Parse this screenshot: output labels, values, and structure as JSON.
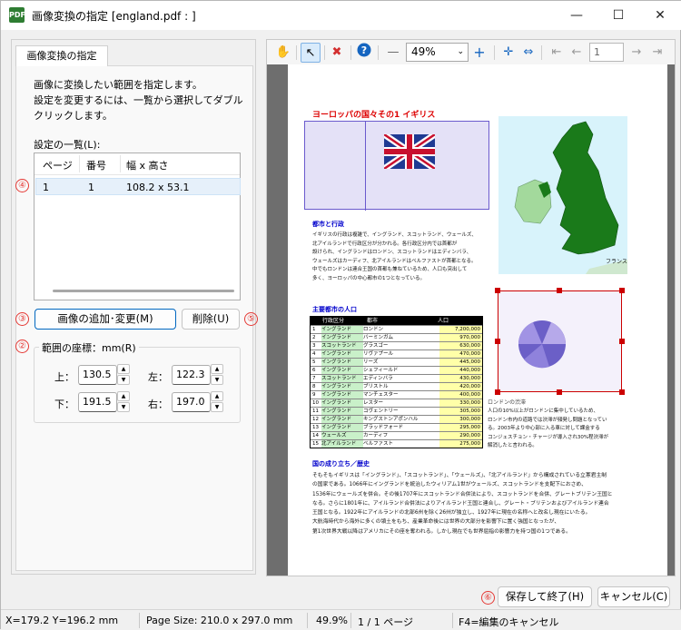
{
  "window": {
    "title": "画像変換の指定 [england.pdf : ]",
    "app_icon": "pdf-app-icon"
  },
  "left_panel": {
    "tab_label": "画像変換の指定",
    "description": [
      "画像に変換したい範囲を指定します。",
      "設定を変更するには、一覧から選択してダブル",
      "クリックします。"
    ],
    "settings_list_label": "設定の一覧(L):",
    "list_columns": [
      "ページ",
      "番号",
      "幅 x 高さ"
    ],
    "list_rows": [
      {
        "page": "1",
        "number": "1",
        "size": "108.2 x 53.1"
      }
    ],
    "add_change_button": "画像の追加･変更(M)",
    "delete_button": "削除(U)",
    "range_group_title": "範囲の座標：mm(R)",
    "coords": {
      "top_label": "上：",
      "top_value": "130.5",
      "left_label": "左：",
      "left_value": "122.3",
      "bottom_label": "下：",
      "bottom_value": "191.5",
      "right_label": "右：",
      "right_value": "197.0"
    }
  },
  "annotations": [
    "①",
    "②",
    "③",
    "④",
    "⑤",
    "⑥"
  ],
  "toolbar": {
    "zoom": "49%",
    "page_number": "1"
  },
  "document": {
    "heading": "ヨーロッパの国々その1 イギリス",
    "section_city": "都市と行政",
    "section_major": "主要都市の人口",
    "section_history": "国の成り立ち／歴史",
    "city_text": [
      "イギリスの行政は複雑で、イングランド、スコットランド、ウェールズ、",
      "北アイルランドで行政区分が分かれる。各行政区分内では首都が",
      "設けられ、イングランドはロンドン、スコットランドはエディンバラ、",
      "ウェールズはカーディフ、北アイルランドはベルファストが首都となる。",
      "中でもロンドンは連合王国の首都も兼ねているため、人口も突出して",
      "多く、ヨーロッパの中心都市の1つとなっている。"
    ],
    "table_headers": [
      "行政区分",
      "都市",
      "人口"
    ],
    "table_rows": [
      [
        "1",
        "イングランド",
        "ロンドン",
        "7,200,000"
      ],
      [
        "2",
        "イングランド",
        "バーミンガム",
        "970,000"
      ],
      [
        "3",
        "スコットランド",
        "グラスゴー",
        "630,000"
      ],
      [
        "4",
        "イングランド",
        "リヴァプール",
        "470,000"
      ],
      [
        "5",
        "イングランド",
        "リーズ",
        "445,000"
      ],
      [
        "6",
        "イングランド",
        "シェフィールド",
        "440,000"
      ],
      [
        "7",
        "スコットランド",
        "エディンバラ",
        "430,000"
      ],
      [
        "8",
        "イングランド",
        "ブリストル",
        "420,000"
      ],
      [
        "9",
        "イングランド",
        "マンチェスター",
        "400,000"
      ],
      [
        "10",
        "イングランド",
        "レスター",
        "330,000"
      ],
      [
        "11",
        "イングランド",
        "コヴェントリー",
        "305,000"
      ],
      [
        "12",
        "イングランド",
        "キングストンアポンハル",
        "300,000"
      ],
      [
        "13",
        "イングランド",
        "ブラッドフォード",
        "295,000"
      ],
      [
        "14",
        "ウェールズ",
        "カーディフ",
        "290,000"
      ],
      [
        "15",
        "北アイルランド",
        "ベルファスト",
        "275,000"
      ]
    ],
    "london_caption": "ロンドンの渋滞",
    "london_text": [
      "人口の10%以上がロンドンに集中しているため、",
      "ロンドン市内の道路では渋滞が頻発し問題となってい",
      "る。2003年より中心部に入る車に対して課金する",
      "コンジェスチョン・チャージが導入され30%程渋滞が",
      "解消したと言われる。"
    ],
    "history_text": [
      "そもそもイギリスは「イングランド」、「スコットランド」、「ウェールズ」、「北アイルランド」から構成されている立憲君主制",
      "の国家である。1066年にイングランドを統治したウィリアム1世がウェールズ、スコットランドを支配下におさめ、",
      "1536年にウェールズを併合。その後1707年にスコットランド合併法により、スコットランドを合併、グレートブリテン王国と",
      "なる。さらに1801年に、アイルランド合併法によりアイルランド王国と連合し、グレート・ブリテンおよびアイルランド連合",
      "王国となる。1922年にアイルランドの北部6州を除く26州が独立し、1927年に現在の名称へと改名し現在にいたる。",
      "大航海時代から海外に多くの領土をもち、産業革命後には世界の大部分を影響下に置く強国となったが、",
      "第1次世界大戦以降はアメリカにその座を奪われる。しかし現在でも世界屈指の影響力を持つ国の1つである。"
    ],
    "map_label": "フランス"
  },
  "bottom_buttons": {
    "save_exit": "保存して終了(H)",
    "cancel": "キャンセル(C)"
  },
  "status": {
    "coords": "X=179.2 Y=196.2 mm",
    "page_size": "Page Size: 210.0 x 297.0 mm",
    "zoom": "49.9%",
    "pages": "1 / 1 ページ",
    "hint": "F4=編集のキャンセル"
  },
  "colors": {
    "accent": "#0067c0",
    "marker": "#e53935",
    "selection": "#cc0000",
    "map_land": "#1a7a1a",
    "map_sea": "#d8f3fb"
  }
}
